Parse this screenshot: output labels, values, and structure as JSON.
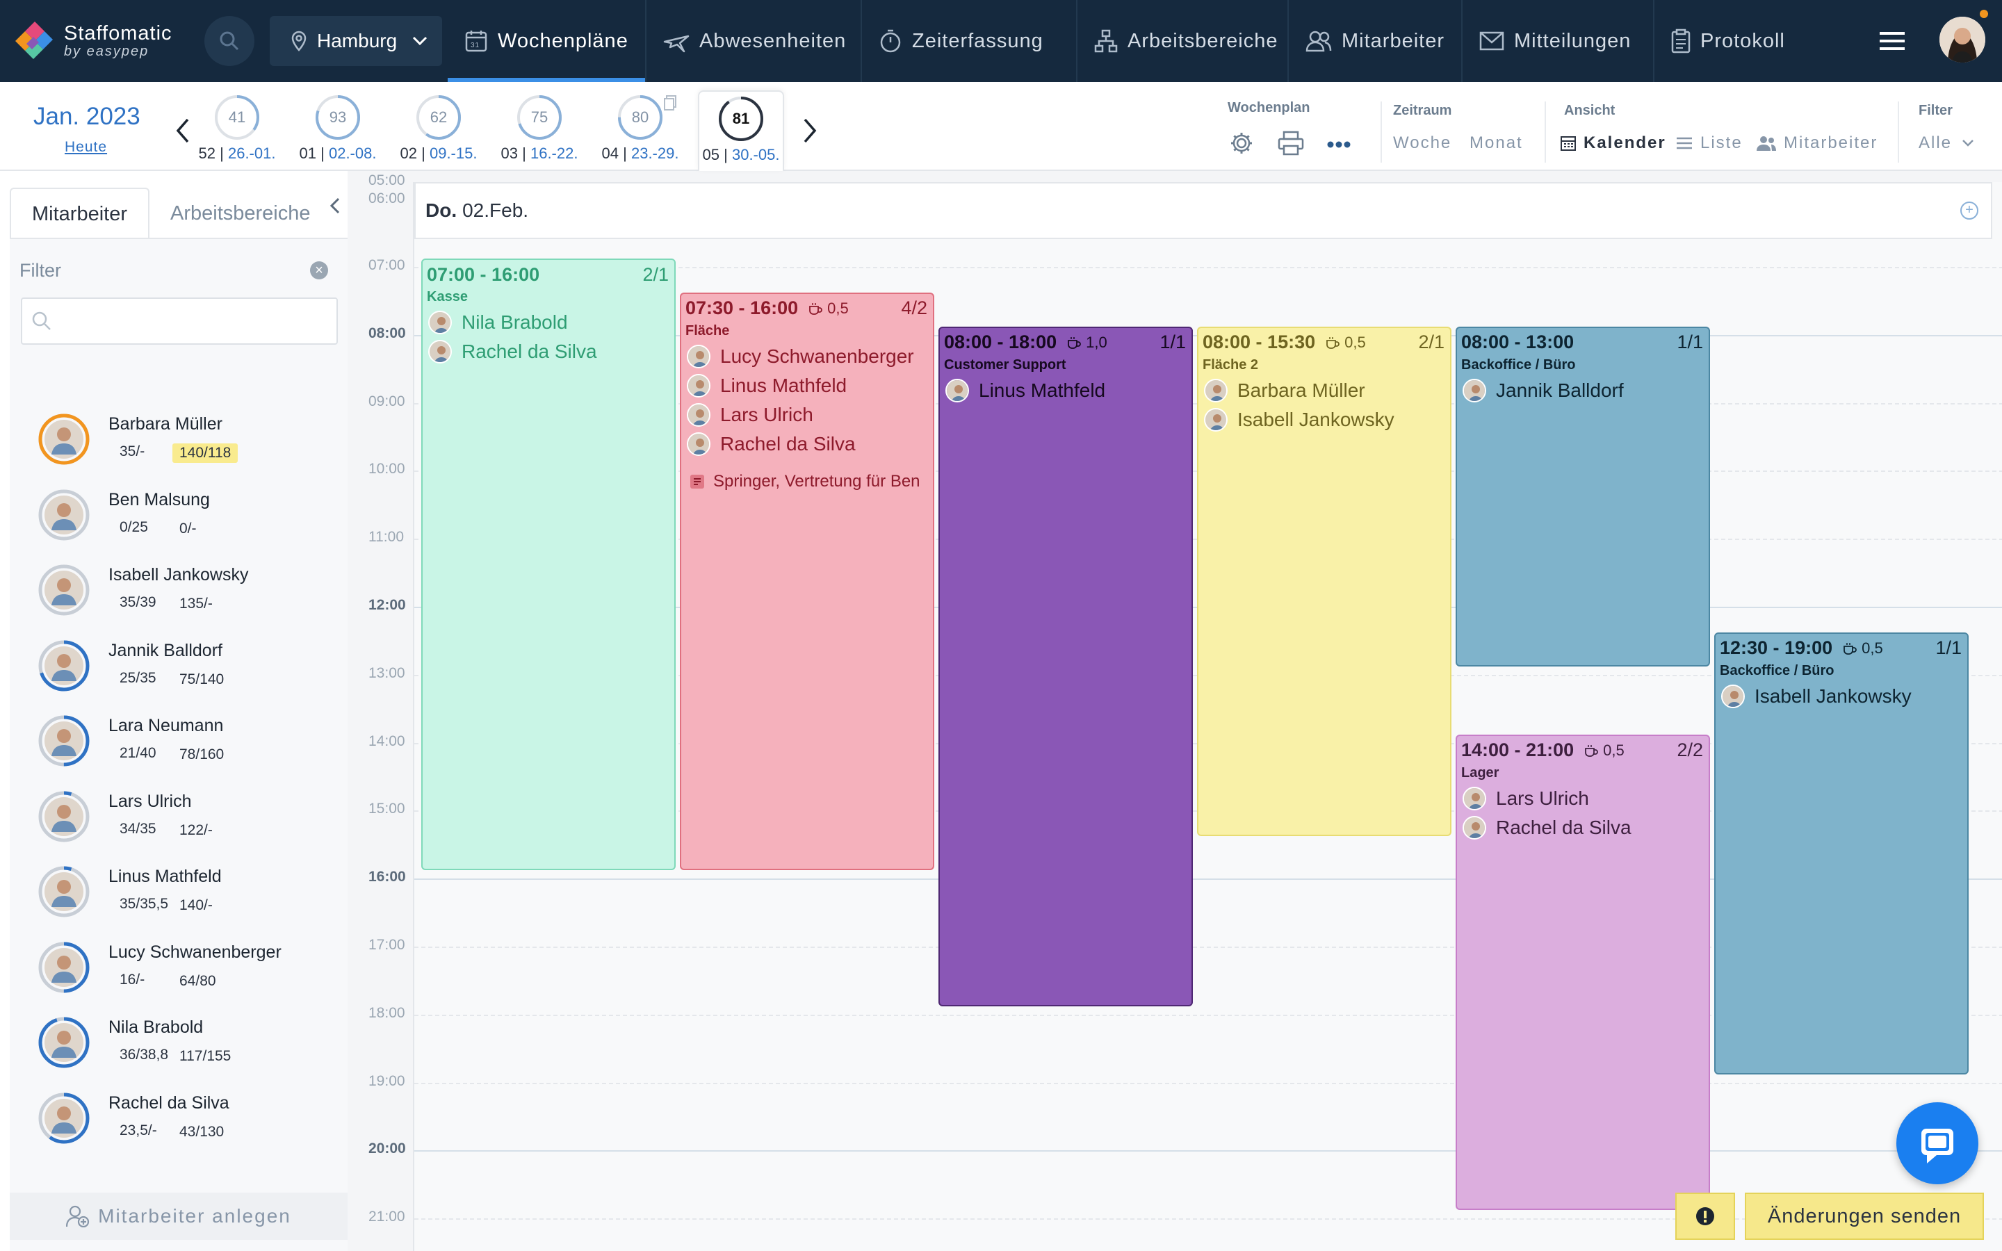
{
  "app": {
    "name": "Staffomatic",
    "tagline": "by easypep"
  },
  "location": "Hamburg",
  "nav": [
    {
      "label": "Wochenpläne",
      "icon": "calendar-icon"
    },
    {
      "label": "Abwesenheiten",
      "icon": "plane-icon"
    },
    {
      "label": "Zeiterfassung",
      "icon": "stopwatch-icon"
    },
    {
      "label": "Arbeitsbereiche",
      "icon": "sitemap-icon"
    },
    {
      "label": "Mitarbeiter",
      "icon": "users-icon"
    },
    {
      "label": "Mitteilungen",
      "icon": "envelope-icon"
    },
    {
      "label": "Protokoll",
      "icon": "clipboard-icon"
    }
  ],
  "period": {
    "month": "Jan. 2023",
    "today": "Heute"
  },
  "weeks": [
    {
      "num": "41",
      "label_kw": "52",
      "label_range": "26.-01.",
      "fill": 0.35
    },
    {
      "num": "93",
      "label_kw": "01",
      "label_range": "02.-08.",
      "fill": 0.8
    },
    {
      "num": "62",
      "label_kw": "02",
      "label_range": "09.-15.",
      "fill": 0.6
    },
    {
      "num": "75",
      "label_kw": "03",
      "label_range": "16.-22.",
      "fill": 0.7
    },
    {
      "num": "80",
      "label_kw": "04",
      "label_range": "23.-29.",
      "fill": 0.75
    },
    {
      "num": "81",
      "label_kw": "05",
      "label_range": "30.-05.",
      "fill": 0.9
    }
  ],
  "toolbar": {
    "wochenplan": "Wochenplan",
    "zeitraum": "Zeitraum",
    "woche": "Woche",
    "monat": "Monat",
    "ansicht": "Ansicht",
    "kalender": "Kalender",
    "liste": "Liste",
    "mitarbeiter": "Mitarbeiter",
    "filter": "Filter",
    "alle": "Alle"
  },
  "panel": {
    "tab_employees": "Mitarbeiter",
    "tab_areas": "Arbeitsbereiche",
    "filter_label": "Filter",
    "add_employee": "Mitarbeiter anlegen"
  },
  "employees": [
    {
      "name": "Barbara Müller",
      "s1": "35/-",
      "s2": "140/118",
      "highlight": true,
      "ring": "#f2951f",
      "ring_fill": 1.0
    },
    {
      "name": "Ben Malsung",
      "s1": "0/25",
      "s2": "0/-",
      "highlight": false,
      "ring": "#c8ced6",
      "ring_fill": 0
    },
    {
      "name": "Isabell Jankowsky",
      "s1": "35/39",
      "s2": "135/-",
      "highlight": false,
      "ring": "#2f72c4",
      "ring_fill": 0.0
    },
    {
      "name": "Jannik Balldorf",
      "s1": "25/35",
      "s2": "75/140",
      "highlight": false,
      "ring": "#2f72c4",
      "ring_fill": 0.7
    },
    {
      "name": "Lara Neumann",
      "s1": "21/40",
      "s2": "78/160",
      "highlight": false,
      "ring": "#2f72c4",
      "ring_fill": 0.5
    },
    {
      "name": "Lars Ulrich",
      "s1": "34/35",
      "s2": "122/-",
      "highlight": false,
      "ring": "#2f72c4",
      "ring_fill": 0.05
    },
    {
      "name": "Linus Mathfeld",
      "s1": "35/35,5",
      "s2": "140/-",
      "highlight": false,
      "ring": "#2f72c4",
      "ring_fill": 0.05
    },
    {
      "name": "Lucy Schwanenberger",
      "s1": "16/-",
      "s2": "64/80",
      "highlight": false,
      "ring": "#2f72c4",
      "ring_fill": 0.5
    },
    {
      "name": "Nila Brabold",
      "s1": "36/38,8",
      "s2": "117/155",
      "highlight": false,
      "ring": "#2f72c4",
      "ring_fill": 0.95
    },
    {
      "name": "Rachel da Silva",
      "s1": "23,5/-",
      "s2": "43/130",
      "highlight": false,
      "ring": "#2f72c4",
      "ring_fill": 0.6
    }
  ],
  "hours": [
    "05:00",
    "06:00",
    "07:00",
    "08:00",
    "09:00",
    "10:00",
    "11:00",
    "12:00",
    "13:00",
    "14:00",
    "15:00",
    "16:00",
    "17:00",
    "18:00",
    "19:00",
    "20:00",
    "21:00"
  ],
  "day": {
    "weekday": "Do.",
    "date": "02.Feb."
  },
  "shifts": [
    {
      "time": "07:00 - 16:00",
      "break": "",
      "count": "2/1",
      "area": "Kasse",
      "people": [
        "Nila Brabold",
        "Rachel da Silva"
      ],
      "note": "",
      "bg": "#c9f5e6",
      "border": "#7fd9b9",
      "fg": "#2e9d73",
      "namefg": "#2e9d73"
    },
    {
      "time": "07:30 - 16:00",
      "break": "0,5",
      "count": "4/2",
      "area": "Fläche",
      "people": [
        "Lucy Schwanenberger",
        "Linus Mathfeld",
        "Lars Ulrich",
        "Rachel da Silva"
      ],
      "note": "Springer, Vertretung für Ben",
      "bg": "#f5b1bc",
      "border": "#e0707f",
      "fg": "#8d1a2b",
      "namefg": "#8d1a2b"
    },
    {
      "time": "08:00 - 18:00",
      "break": "1,0",
      "count": "1/1",
      "area": "Customer Support",
      "people": [
        "Linus Mathfeld"
      ],
      "note": "",
      "bg": "#8a57b6",
      "border": "#4f2873",
      "fg": "#16091f",
      "namefg": "#16091f"
    },
    {
      "time": "08:00 - 15:30",
      "break": "0,5",
      "count": "2/1",
      "area": "Fläche 2",
      "people": [
        "Barbara Müller",
        "Isabell Jankowsky"
      ],
      "note": "",
      "bg": "#f9f1a8",
      "border": "#e8dc73",
      "fg": "#6e6420",
      "namefg": "#6e6420"
    },
    {
      "time": "08:00 - 13:00",
      "break": "",
      "count": "1/1",
      "area": "Backoffice / Büro",
      "people": [
        "Jannik Balldorf"
      ],
      "note": "",
      "bg": "#7fb3cb",
      "border": "#4c87a3",
      "fg": "#0d2431",
      "namefg": "#0d2431"
    },
    {
      "time": "12:30 - 19:00",
      "break": "0,5",
      "count": "1/1",
      "area": "Backoffice / Büro",
      "people": [
        "Isabell Jankowsky"
      ],
      "note": "",
      "bg": "#7fb3cb",
      "border": "#4c87a3",
      "fg": "#0d2431",
      "namefg": "#0d2431"
    },
    {
      "time": "14:00 - 21:00",
      "break": "0,5",
      "count": "2/2",
      "area": "Lager",
      "people": [
        "Lars Ulrich",
        "Rachel da Silva"
      ],
      "note": "",
      "bg": "#dcaede",
      "border": "#c77ec9",
      "fg": "#3d1f3e",
      "namefg": "#3d1f3e"
    }
  ],
  "actions": {
    "send": "Änderungen senden"
  }
}
